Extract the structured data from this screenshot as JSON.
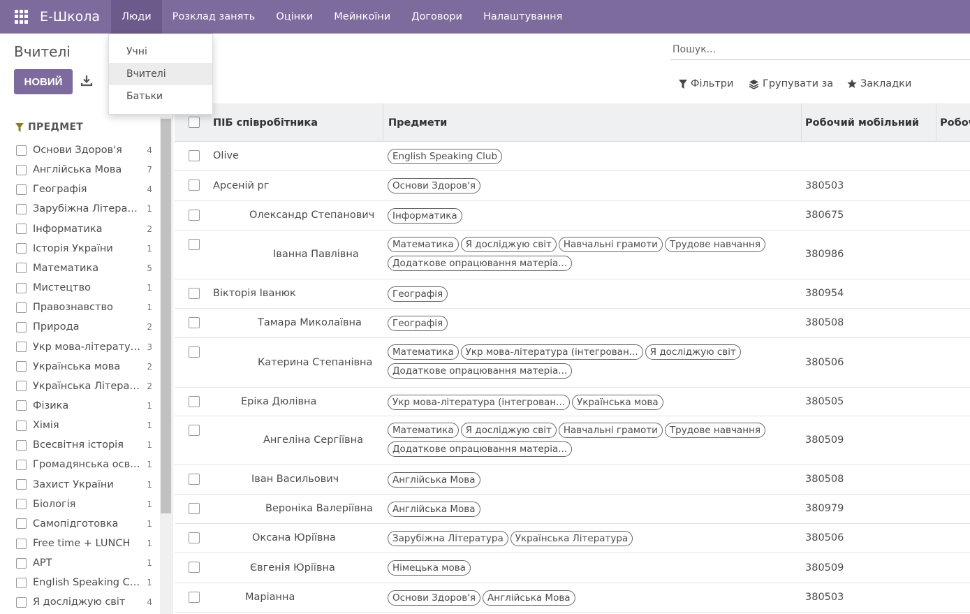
{
  "navbar": {
    "brand": "Е-Школа",
    "menu": [
      "Люди",
      "Розклад занять",
      "Оцінки",
      "Мейнкоїни",
      "Договори",
      "Налаштування"
    ]
  },
  "dropdown": {
    "items": [
      "Учні",
      "Вчителі",
      "Батьки"
    ]
  },
  "control": {
    "title": "Вчителі",
    "new_button": "НОВИЙ",
    "search_placeholder": "Пошук...",
    "filters": "Фільтри",
    "group_by": "Групувати за",
    "favorites": "Закладки"
  },
  "sidebar": {
    "header": "ПРЕДМЕТ",
    "facets": [
      {
        "label": "Основи Здоров'я",
        "count": "4"
      },
      {
        "label": "Англійська Мова",
        "count": "7"
      },
      {
        "label": "Географія",
        "count": "4"
      },
      {
        "label": "Зарубіжна Література",
        "count": "1"
      },
      {
        "label": "Інформатика",
        "count": "2"
      },
      {
        "label": "Історія України",
        "count": "1"
      },
      {
        "label": "Математика",
        "count": "5"
      },
      {
        "label": "Мистецтво",
        "count": "1"
      },
      {
        "label": "Правознавство",
        "count": "1"
      },
      {
        "label": "Природа",
        "count": "2"
      },
      {
        "label": "Укр мова-література (інтегрований)",
        "count": "3"
      },
      {
        "label": "Українська мова",
        "count": "2"
      },
      {
        "label": "Українська Література",
        "count": "2"
      },
      {
        "label": "Фізика",
        "count": "1"
      },
      {
        "label": "Хімія",
        "count": "1"
      },
      {
        "label": "Всесвітня історія",
        "count": "1"
      },
      {
        "label": "Громадянська освіта",
        "count": "1"
      },
      {
        "label": "Захист України",
        "count": "1"
      },
      {
        "label": "Біологія",
        "count": "1"
      },
      {
        "label": "Самопідготовка",
        "count": "1"
      },
      {
        "label": "Free time + LUNCH",
        "count": "1"
      },
      {
        "label": "АРТ",
        "count": "1"
      },
      {
        "label": "English Speaking Club",
        "count": "1"
      },
      {
        "label": "Я досліджую світ",
        "count": "4"
      }
    ]
  },
  "table": {
    "columns": [
      "ПІБ співробітника",
      "Предмети",
      "Робочий мобільний",
      "Робочий"
    ],
    "rows": [
      {
        "name": "Olive",
        "subjects": [
          "English Speaking Club"
        ],
        "phone": ""
      },
      {
        "name": "Арсеній              рг",
        "subjects": [
          "Основи Здоров'я"
        ],
        "phone": "380503"
      },
      {
        "name": "Олександр Степанович",
        "subjects": [
          "Інформатика"
        ],
        "phone": "380675"
      },
      {
        "name": "Іванна Павлівна",
        "subjects": [
          "Математика",
          "Я досліджую світ",
          "Навчальні грамоти",
          "Трудове навчання",
          "Додаткове опрацювання матеріа..."
        ],
        "phone": "380986"
      },
      {
        "name": "Вікторія Іванюк",
        "subjects": [
          "Географія"
        ],
        "phone": "380954"
      },
      {
        "name": "Тамара Миколаївна",
        "subjects": [
          "Географія"
        ],
        "phone": "380508"
      },
      {
        "name": "Катерина Степанівна",
        "subjects": [
          "Математика",
          "Укр мова-література (інтегрован...",
          "Я досліджую світ",
          "Додаткове опрацювання матеріа..."
        ],
        "phone": "380506"
      },
      {
        "name": "Еріка Дюлівна",
        "subjects": [
          "Укр мова-література (інтегрован...",
          "Українська мова"
        ],
        "phone": "380505"
      },
      {
        "name": "Ангеліна Сергіївна",
        "subjects": [
          "Математика",
          "Я досліджую світ",
          "Навчальні грамоти",
          "Трудове навчання",
          "Додаткове опрацювання матеріа..."
        ],
        "phone": "380509"
      },
      {
        "name": "Іван Васильович",
        "subjects": [
          "Англійська Мова"
        ],
        "phone": "380508"
      },
      {
        "name": "Вероніка Валеріївна",
        "subjects": [
          "Англійська Мова"
        ],
        "phone": "380979"
      },
      {
        "name": "Оксана Юріївна",
        "subjects": [
          "Зарубіжна Література",
          "Українська Література"
        ],
        "phone": "380506"
      },
      {
        "name": "Євгенія Юріївна",
        "subjects": [
          "Німецька мова"
        ],
        "phone": "380509"
      },
      {
        "name": "Маріанна",
        "subjects": [
          "Основи Здоров'я",
          "Англійська Мова"
        ],
        "phone": "380503"
      }
    ]
  }
}
